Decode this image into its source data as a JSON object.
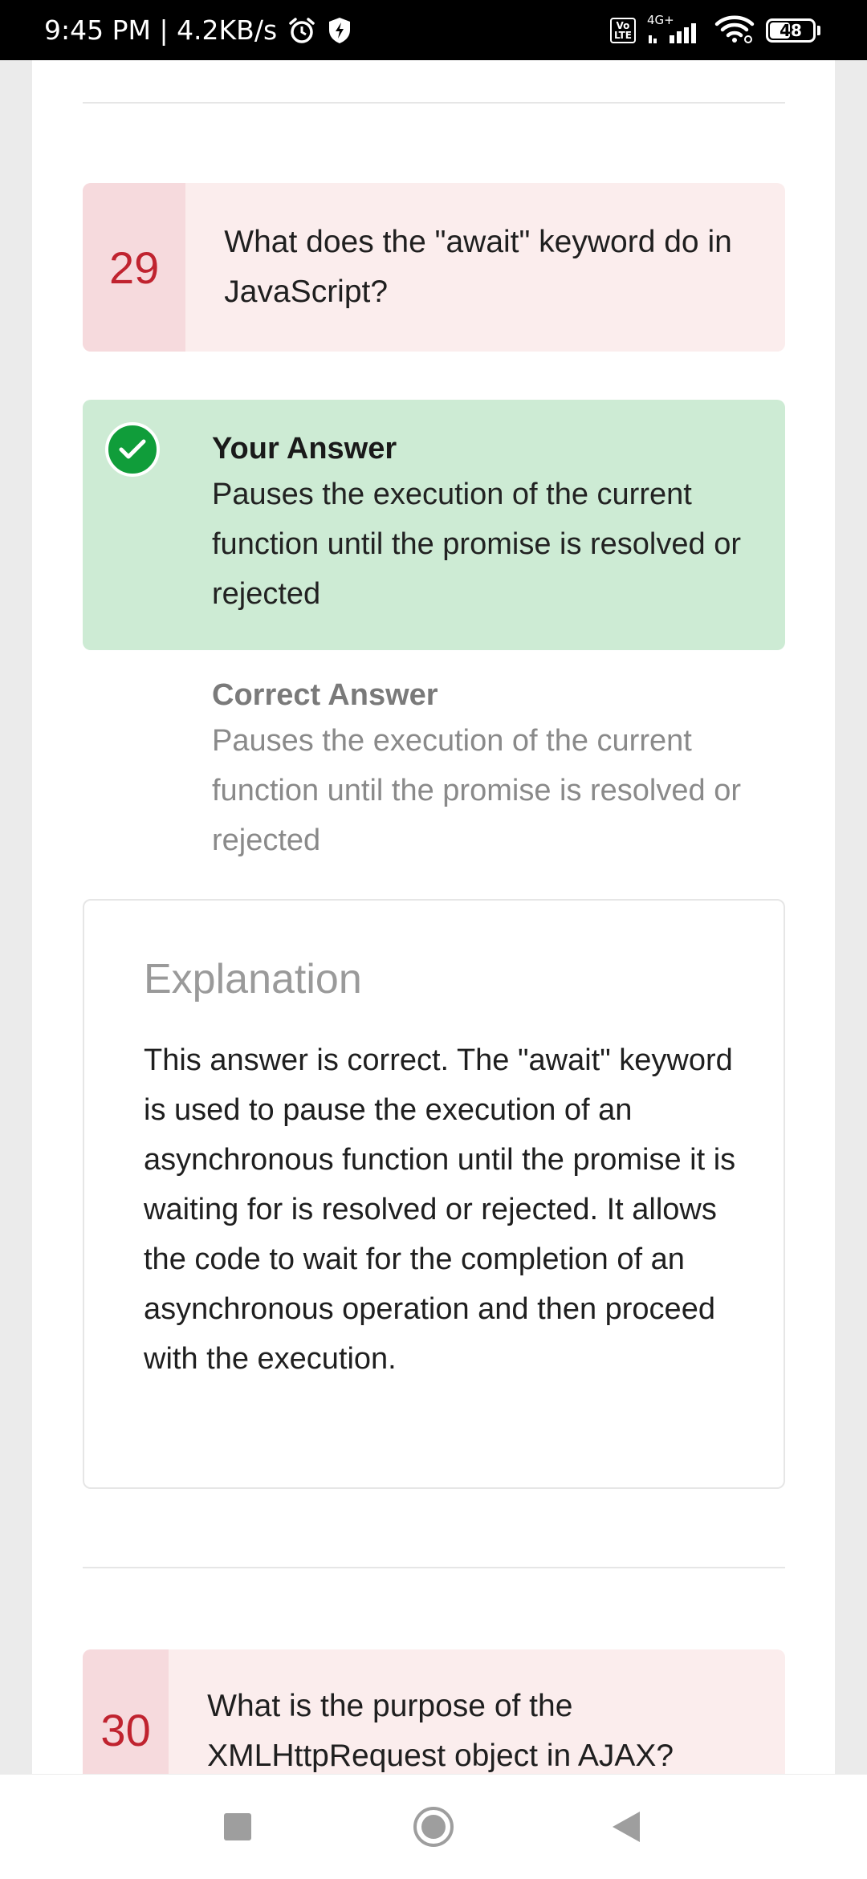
{
  "status_bar": {
    "time_speed": "9:45 PM | 4.2KB/s",
    "network": "4G+",
    "volte": "Vo LTE",
    "battery": "48",
    "battery_level_percent": 48,
    "icons": [
      "alarm-icon",
      "lightning-shield-icon",
      "volte-icon",
      "signal-icon",
      "wifi-icon",
      "battery-icon"
    ]
  },
  "questions": [
    {
      "number": "29",
      "text": "What does the \"await\" keyword do in JavaScript?",
      "your_answer_label": "Your Answer",
      "your_answer": "Pauses the execution of the current function until the promise is resolved or rejected",
      "correct_answer_label": "Correct Answer",
      "correct_answer": "Pauses the execution of the current function until the promise is resolved or rejected",
      "explanation_title": "Explanation",
      "explanation": "This answer is correct. The \"await\" keyword is used to pause the execution of an asynchronous function until the promise it is waiting for is resolved or rejected. It allows the code to wait for the completion of an asynchronous operation and then proceed with the execution."
    },
    {
      "number": "30",
      "text": "What is the purpose of the XMLHttpRequest object in AJAX?"
    }
  ],
  "colors": {
    "question_bg": "#fbeded",
    "question_num_bg": "#f6dadd",
    "question_num": "#c0232f",
    "correct_bg": "#cdebd4",
    "check_green": "#109d3a"
  },
  "nav_bar": {
    "icons": [
      "recents-square-icon",
      "home-circle-icon",
      "back-triangle-icon"
    ]
  }
}
